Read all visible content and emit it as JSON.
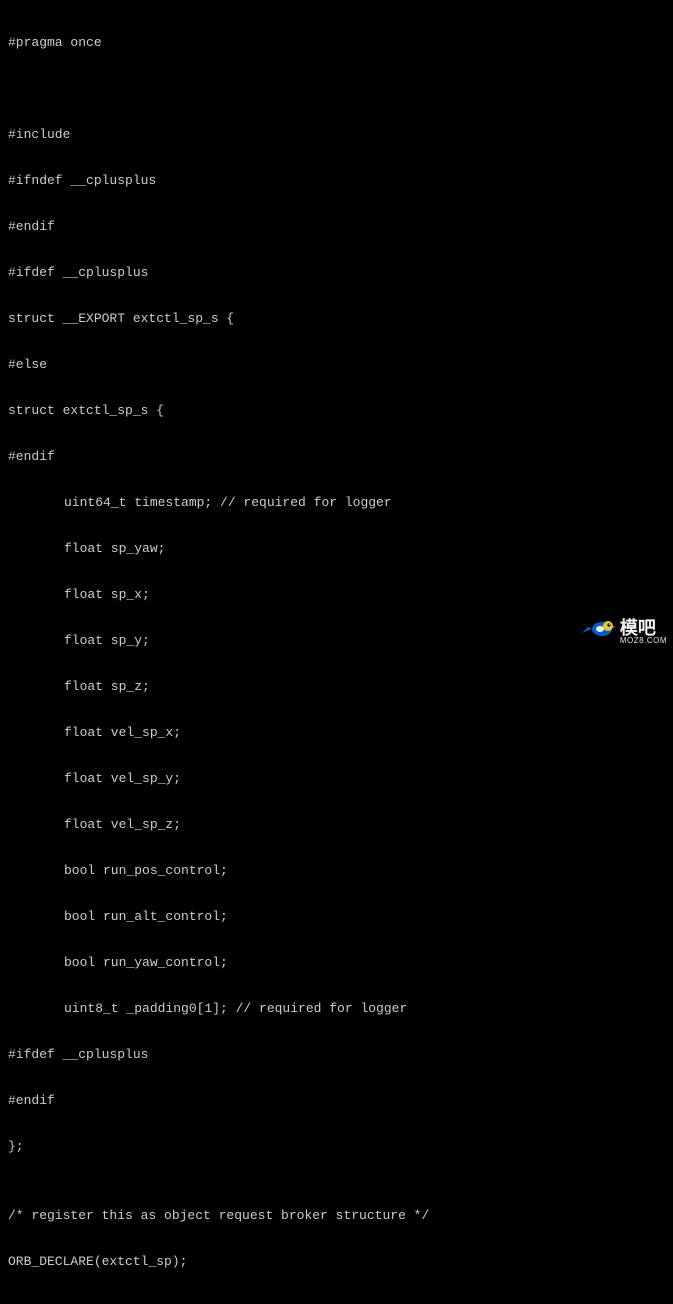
{
  "code": {
    "lines": [
      "#pragma once",
      "",
      "",
      "#include",
      "#ifndef __cplusplus",
      "#endif",
      "#ifdef __cplusplus",
      "struct __EXPORT extctl_sp_s {",
      "#else",
      "struct extctl_sp_s {",
      "#endif"
    ],
    "indented": [
      "uint64_t timestamp; // required for logger",
      "float sp_yaw;",
      "float sp_x;",
      "float sp_y;",
      "float sp_z;",
      "float vel_sp_x;",
      "float vel_sp_y;",
      "float vel_sp_z;",
      "bool run_pos_control;",
      "bool run_alt_control;",
      "bool run_yaw_control;",
      "uint8_t _padding0[1]; // required for logger"
    ],
    "tail": [
      "#ifdef __cplusplus",
      "#endif",
      "};",
      "",
      "/* register this as object request broker structure */",
      "ORB_DECLARE(extctl_sp);"
    ]
  },
  "watermark": {
    "text": "模吧",
    "url": "MOZ8.COM"
  }
}
